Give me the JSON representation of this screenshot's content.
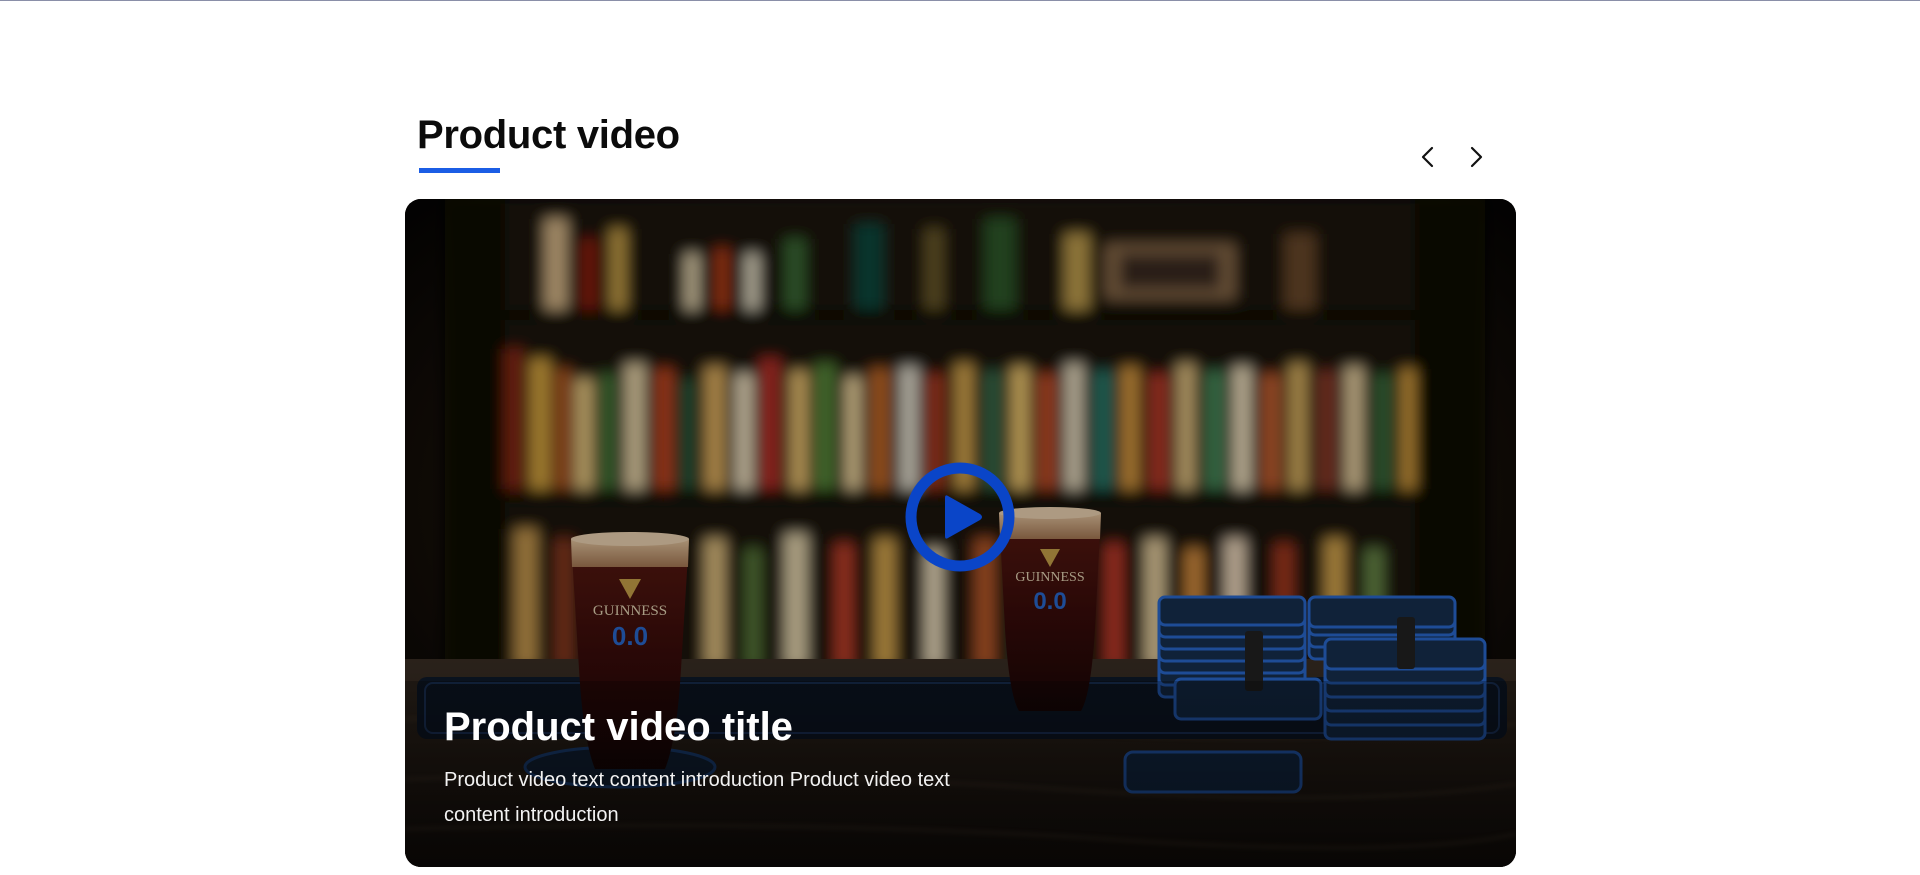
{
  "section": {
    "title": "Product video",
    "accent_color": "#1b5de5"
  },
  "carousel": {
    "prev_icon": "chevron-left-icon",
    "next_icon": "chevron-right-icon"
  },
  "video": {
    "title": "Product video title",
    "description": "Product video text content introduction Product video text content introduction",
    "play_icon": "play-icon",
    "play_color": "#0a45c8",
    "glass_brand_text": "GUINNESS",
    "glass_number_text": "0.0"
  }
}
